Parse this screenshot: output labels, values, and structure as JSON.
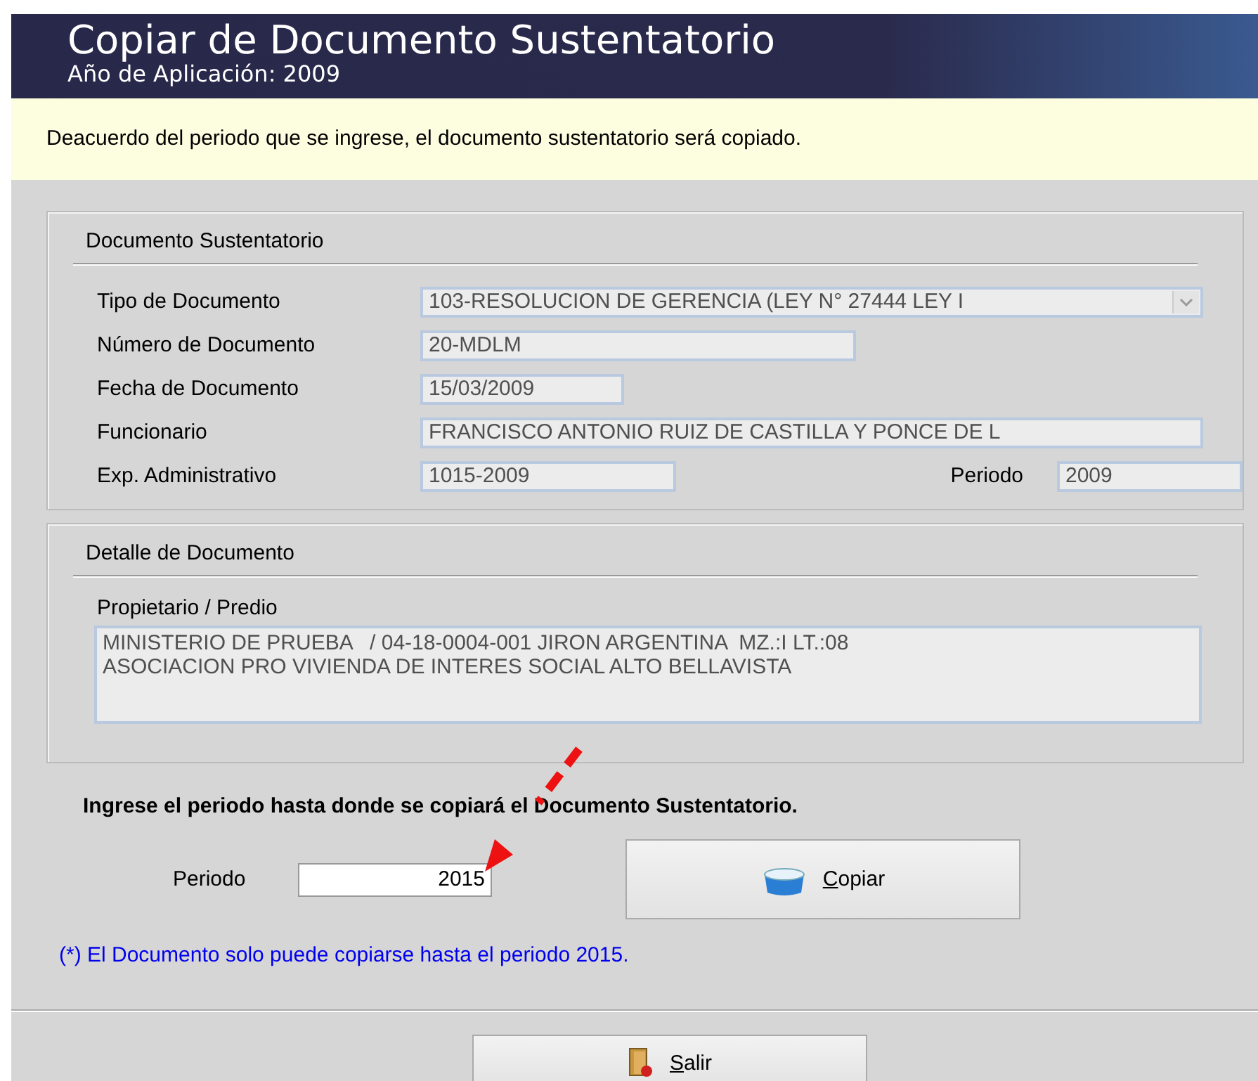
{
  "header": {
    "title": "Copiar de Documento Sustentatorio",
    "subtitle": "Año de Aplicación: 2009"
  },
  "info": "Deacuerdo del periodo que se ingrese, el documento sustentatorio será copiado.",
  "documento_group": {
    "title": "Documento Sustentatorio",
    "rows": [
      {
        "fields": [
          {
            "label": "Tipo de Documento",
            "value": "103-RESOLUCION DE GERENCIA (LEY N° 27444 LEY I",
            "kind": "dropdown"
          }
        ]
      },
      {
        "fields": [
          {
            "label": "Número de Documento",
            "value": "20-MDLM",
            "kind": "text"
          }
        ]
      },
      {
        "fields": [
          {
            "label": "Fecha de Documento",
            "value": "15/03/2009",
            "kind": "text"
          }
        ]
      },
      {
        "fields": [
          {
            "label": "Funcionario",
            "value": "FRANCISCO ANTONIO RUIZ DE CASTILLA Y PONCE DE L",
            "kind": "text"
          }
        ]
      },
      {
        "fields": [
          {
            "label": "Exp. Administrativo",
            "value": "1015-2009",
            "kind": "text"
          },
          {
            "label": "Periodo",
            "value": "2009",
            "kind": "text"
          }
        ]
      }
    ]
  },
  "detalle_group": {
    "title": "Detalle de Documento",
    "label": "Propietario / Predio",
    "value_lines": [
      "MINISTERIO DE PRUEBA   / 04-18-0004-001 JIRON ARGENTINA  MZ.:I LT.:08",
      "ASOCIACION PRO VIVIENDA DE INTERES SOCIAL ALTO BELLAVISTA"
    ]
  },
  "prompt": "Ingrese el periodo hasta donde se copiará el Documento Sustentatorio.",
  "periodo": {
    "label": "Periodo",
    "value": "2015"
  },
  "copy_button": "Copiar",
  "note": "(*) El Documento solo puede copiarse hasta el periodo 2015.",
  "exit_button": "Salir"
}
